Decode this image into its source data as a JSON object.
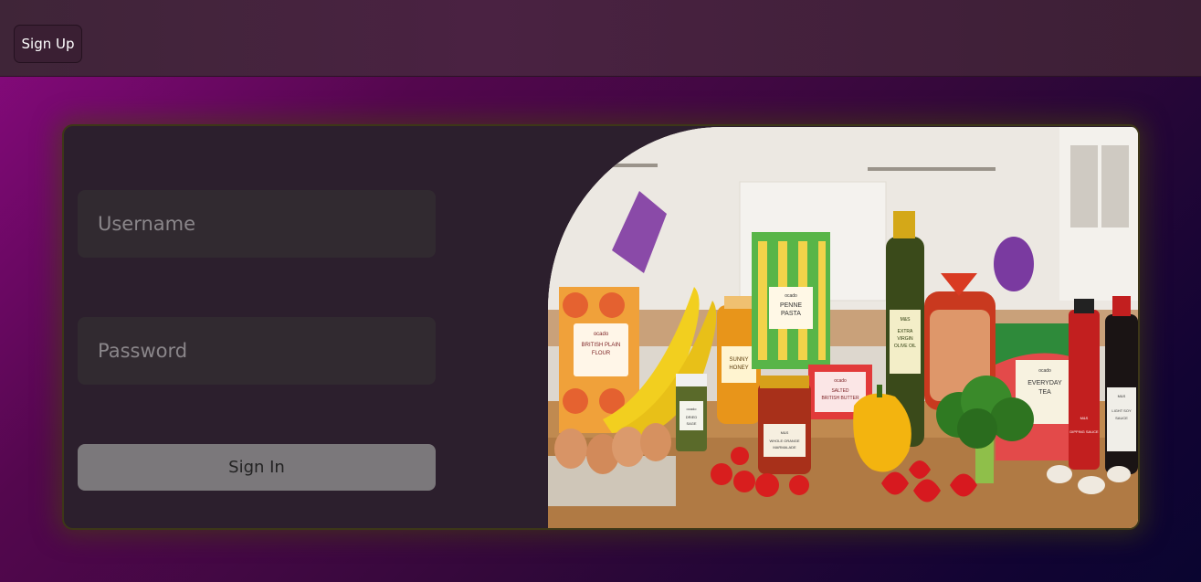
{
  "header": {
    "signup_label": "Sign Up"
  },
  "login": {
    "username_placeholder": "Username",
    "password_placeholder": "Password",
    "signin_label": "Sign In"
  },
  "hero_image": {
    "labels": {
      "flour": [
        "ocado",
        "BRITISH PLAIN",
        "FLOUR"
      ],
      "pasta": [
        "ocado",
        "PENNE",
        "PASTA"
      ],
      "honey": [
        "SUNNY",
        "HONEY"
      ],
      "oil": [
        "M&S",
        "EXTRA",
        "VIRGIN",
        "OLIVE OIL"
      ],
      "butter": [
        "ocado",
        "SALTED",
        "BRITISH BUTTER"
      ],
      "tea": [
        "ocado",
        "EVERYDAY",
        "TEA"
      ],
      "marmalade": [
        "M&S",
        "WHOLE ORANGE",
        "MARMALADE"
      ],
      "dipping": [
        "M&S",
        "DIPPING SAUCE"
      ],
      "soy": [
        "M&S",
        "LIGHT SOY",
        "SAUCE"
      ],
      "herb": [
        "ocado",
        "DRIED",
        "SAGE"
      ]
    }
  },
  "colors": {
    "accent_card_border": "#3d3718",
    "signin_button": "#7b787b",
    "topbar": "#4a2242"
  }
}
